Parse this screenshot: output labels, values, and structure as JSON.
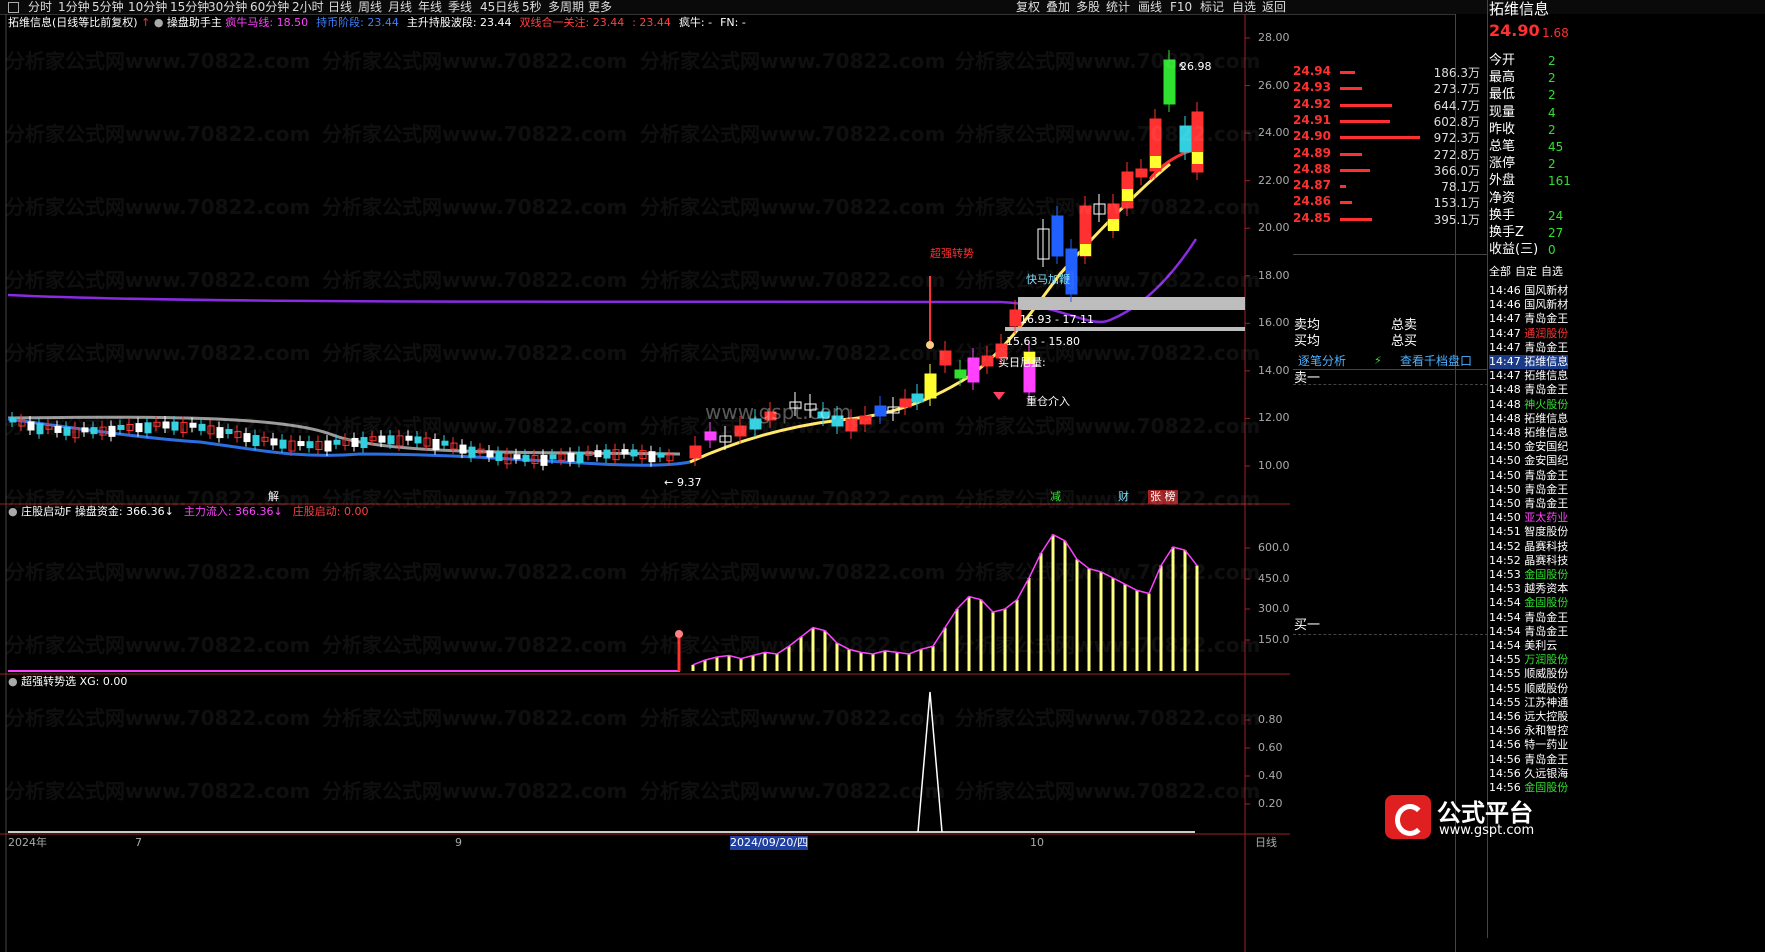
{
  "topbar": {
    "period_tabs": [
      "分时",
      "1分钟",
      "5分钟",
      "10分钟",
      "15分钟",
      "30分钟",
      "60分钟",
      "2小时",
      "日线",
      "周线",
      "月线",
      "年线",
      "季线",
      "45日线",
      "5秒",
      "多周期",
      "更多"
    ],
    "right_tools": [
      "复权",
      "叠加",
      "多股",
      "统计",
      "画线",
      "F10",
      "标记",
      "自选",
      "返回"
    ]
  },
  "main_header": {
    "stock": "拓维信息(日线等比前复权)",
    "indicator": "操盘助手主",
    "items": [
      {
        "label": "疯牛马线: 18.50",
        "color": "#ff40ff"
      },
      {
        "label": "持币阶段: 23.44",
        "color": "#4080ff"
      },
      {
        "label": "主升持股波段: 23.44",
        "color": "#ffffff"
      },
      {
        "label": "双线合一关注: 23.44",
        "color": "#ff4040"
      },
      {
        "label": ": 23.44",
        "color": "#ff4040"
      },
      {
        "label": "疯牛: -",
        "color": "#ffffff"
      },
      {
        "label": "FN: -",
        "color": "#ffffff"
      }
    ]
  },
  "price_axis": [
    "28.00",
    "26.00",
    "24.00",
    "22.00",
    "20.00",
    "18.00",
    "16.00",
    "14.00",
    "12.00",
    "10.00"
  ],
  "annotations": {
    "high": "26.98",
    "low": "9.37",
    "super_trend": "超强转势",
    "fast_horse": "快马加鞭",
    "range1": "16.93 - 17.11",
    "range2": "15.63 - 15.80",
    "buy_volume": "买日尼量:",
    "heavy_entry": "重仓介入",
    "watermark_url": "www.gspt.com",
    "marks": [
      "解",
      "减",
      "财",
      "张 榜"
    ]
  },
  "panel2": {
    "name": "庄股启动F",
    "items": [
      {
        "label": "操盘资金: 366.36↓",
        "color": "#ffffff"
      },
      {
        "label": "主力流入: 366.36↓",
        "color": "#ff40ff"
      },
      {
        "label": "庄股启动: 0.00",
        "color": "#ff4040"
      }
    ],
    "axis": [
      "600.0",
      "450.0",
      "300.0",
      "150.0"
    ]
  },
  "panel3": {
    "name": "超强转势选",
    "items": [
      {
        "label": "XG: 0.00",
        "color": "#ffffff"
      }
    ],
    "axis": [
      "0.80",
      "0.60",
      "0.40",
      "0.20"
    ]
  },
  "date_axis": [
    "2024年",
    "7",
    "9",
    "2024/09/20/四",
    "10"
  ],
  "date_axis_right": "日线",
  "right_panel": {
    "title": "拓维信息",
    "price": "24.90",
    "change": "1.68",
    "orderbook": [
      {
        "price": "24.94",
        "vol": "186.3万",
        "len": 15
      },
      {
        "price": "24.93",
        "vol": "273.7万",
        "len": 22
      },
      {
        "price": "24.92",
        "vol": "644.7万",
        "len": 52
      },
      {
        "price": "24.91",
        "vol": "602.8万",
        "len": 50
      },
      {
        "price": "24.90",
        "vol": "972.3万",
        "len": 80
      },
      {
        "price": "24.89",
        "vol": "272.8万",
        "len": 22
      },
      {
        "price": "24.88",
        "vol": "366.0万",
        "len": 30
      },
      {
        "price": "24.87",
        "vol": "78.1万",
        "len": 6
      },
      {
        "price": "24.86",
        "vol": "153.1万",
        "len": 12
      },
      {
        "price": "24.85",
        "vol": "395.1万",
        "len": 32
      }
    ],
    "stats": [
      {
        "label": "今开",
        "value": "2"
      },
      {
        "label": "最高",
        "value": "2"
      },
      {
        "label": "最低",
        "value": "2"
      },
      {
        "label": "现量",
        "value": "4"
      },
      {
        "label": "昨收",
        "value": "2"
      },
      {
        "label": "总笔",
        "value": "45"
      },
      {
        "label": "涨停",
        "value": "2"
      },
      {
        "label": "外盘",
        "value": "161"
      },
      {
        "label": "净资",
        "value": ""
      },
      {
        "label": "换手",
        "value": "24"
      },
      {
        "label": "换手Z",
        "value": "27"
      },
      {
        "label": "收益(三)",
        "value": "0"
      }
    ],
    "filter_tabs": [
      "全部",
      "自定",
      "自选"
    ],
    "sell_avg": "卖均",
    "buy_avg": "买均",
    "total_sell": "总卖",
    "total_buy": "总买",
    "detail_link": "逐笔分析",
    "depth_link": "查看千档盘口",
    "sell1": "卖一",
    "buy1": "买一",
    "ticks": [
      {
        "t": "14:46",
        "n": "国风新材",
        "c": "#ffffff"
      },
      {
        "t": "14:46",
        "n": "国风新材",
        "c": "#ffffff"
      },
      {
        "t": "14:47",
        "n": "青岛金王",
        "c": "#ffffff"
      },
      {
        "t": "14:47",
        "n": "通润股份",
        "c": "#ff3030"
      },
      {
        "t": "14:47",
        "n": "青岛金王",
        "c": "#ffffff"
      },
      {
        "t": "14:47",
        "n": "拓维信息",
        "c": "#ffffff",
        "hl": true
      },
      {
        "t": "14:47",
        "n": "拓维信息",
        "c": "#ffffff"
      },
      {
        "t": "14:48",
        "n": "青岛金王",
        "c": "#ffffff"
      },
      {
        "t": "14:48",
        "n": "神火股份",
        "c": "#30e030"
      },
      {
        "t": "14:48",
        "n": "拓维信息",
        "c": "#ffffff"
      },
      {
        "t": "14:48",
        "n": "拓维信息",
        "c": "#ffffff"
      },
      {
        "t": "14:50",
        "n": "金安国纪",
        "c": "#ffffff"
      },
      {
        "t": "14:50",
        "n": "金安国纪",
        "c": "#ffffff"
      },
      {
        "t": "14:50",
        "n": "青岛金王",
        "c": "#ffffff"
      },
      {
        "t": "14:50",
        "n": "青岛金王",
        "c": "#ffffff"
      },
      {
        "t": "14:50",
        "n": "青岛金王",
        "c": "#ffffff"
      },
      {
        "t": "14:50",
        "n": "亚太药业",
        "c": "#ff40ff"
      },
      {
        "t": "14:51",
        "n": "智度股份",
        "c": "#ffffff"
      },
      {
        "t": "14:52",
        "n": "晶赛科技",
        "c": "#ffffff"
      },
      {
        "t": "14:52",
        "n": "晶赛科技",
        "c": "#ffffff"
      },
      {
        "t": "14:53",
        "n": "金固股份",
        "c": "#30e030"
      },
      {
        "t": "14:53",
        "n": "越秀资本",
        "c": "#ffffff"
      },
      {
        "t": "14:54",
        "n": "金固股份",
        "c": "#30e030"
      },
      {
        "t": "14:54",
        "n": "青岛金王",
        "c": "#ffffff"
      },
      {
        "t": "14:54",
        "n": "青岛金王",
        "c": "#ffffff"
      },
      {
        "t": "14:54",
        "n": "美利云",
        "c": "#ffffff"
      },
      {
        "t": "14:55",
        "n": "万润股份",
        "c": "#30e030"
      },
      {
        "t": "14:55",
        "n": "顺威股份",
        "c": "#ffffff"
      },
      {
        "t": "14:55",
        "n": "顺威股份",
        "c": "#ffffff"
      },
      {
        "t": "14:55",
        "n": "江苏神通",
        "c": "#ffffff"
      },
      {
        "t": "14:56",
        "n": "远大控股",
        "c": "#ffffff"
      },
      {
        "t": "14:56",
        "n": "永和智控",
        "c": "#ffffff"
      },
      {
        "t": "14:56",
        "n": "特一药业",
        "c": "#ffffff"
      },
      {
        "t": "14:56",
        "n": "青岛金王",
        "c": "#ffffff"
      },
      {
        "t": "14:56",
        "n": "久远银海",
        "c": "#ffffff"
      },
      {
        "t": "14:56",
        "n": "金固股份",
        "c": "#30e030"
      }
    ]
  },
  "watermark": "分析家公式网www.70822.com",
  "logo": {
    "main": "公式平台",
    "sub": "www.gspt.com"
  }
}
